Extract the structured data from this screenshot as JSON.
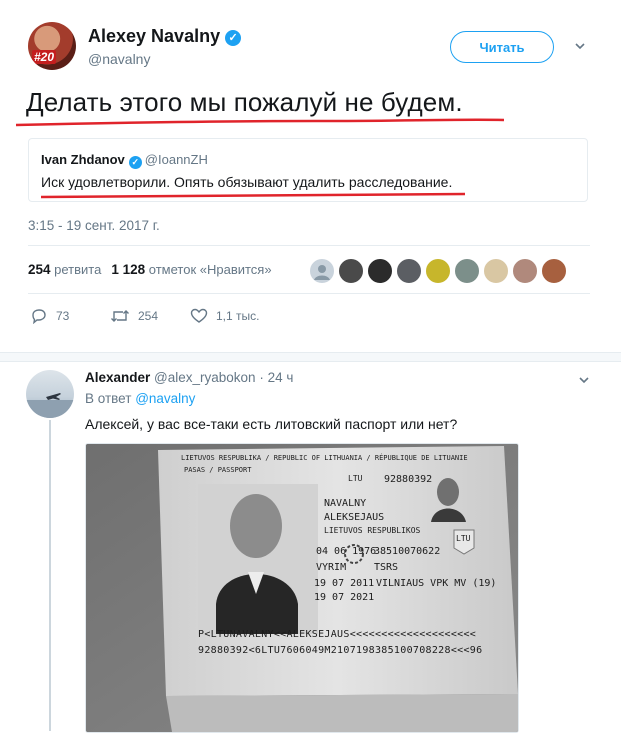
{
  "tweet": {
    "author_name": "Alexey Navalny",
    "author_handle": "@navalny",
    "avatar_badge": "#20",
    "follow_label": "Читать",
    "text": "Делать этого мы пожалуй не будем.",
    "timestamp": "3:15 - 19 сент. 2017 г.",
    "stats": {
      "retweets_count": "254",
      "retweets_label": "ретвита",
      "likes_count": "1 128",
      "likes_label": "отметок «Нравится»"
    },
    "actions": {
      "replies": "73",
      "retweets": "254",
      "likes": "1,1 тыс."
    }
  },
  "quote": {
    "author_name": "Ivan Zhdanov",
    "author_handle": "@IoannZH",
    "text": "Иск удовлетворили. Опять обязывают удалить расследование."
  },
  "reply": {
    "author_name": "Alexander",
    "author_handle": "@alex_ryabokon",
    "time": "24 ч",
    "in_reply_label": "В ответ",
    "in_reply_handle": "@navalny",
    "text": "Алексей, у вас все-таки есть литовский паспорт или нет?"
  },
  "passport": {
    "header": "LIETUVOS RESPUBLIKA / REPUBLIC OF LITHUANIA / RÉPUBLIQUE DE LITUANIE",
    "type_label": "PASAS / PASSPORT",
    "code": "LTU",
    "number": "92880392",
    "surname": "NAVALNY",
    "given_name": "ALEKSEJAUS",
    "nationality": "LIETUVOS RESPUBLIKOS",
    "dob": "04 06 1976",
    "personal_no": "38510070622",
    "sex": "VYRIM",
    "place": "TSRS",
    "issued": "19 07 2011",
    "authority": "VILNIAUS VPK MV (19)",
    "expiry": "19 07 2021",
    "country_badge": "LTU",
    "mrz1": "P<LTUNAVALNY<<ALEKSEJAUS<<<<<<<<<<<<<<<<<<<<",
    "mrz2": "92880392<6LTU7606049M2107198385100708228<<<96"
  },
  "colors": {
    "accent": "#1da1f2",
    "underline": "#e0242b"
  }
}
